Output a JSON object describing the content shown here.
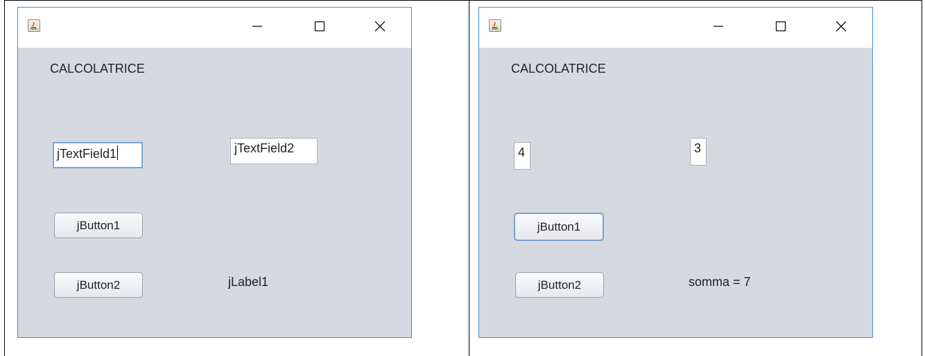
{
  "panels": [
    {
      "title_label": "CALCOLATRICE",
      "field1": {
        "value": "jTextField1"
      },
      "field2": {
        "value": "jTextField2"
      },
      "button1_label": "jButton1",
      "button2_label": "jButton2",
      "result_label": "jLabel1"
    },
    {
      "title_label": "CALCOLATRICE",
      "field1": {
        "value": "4"
      },
      "field2": {
        "value": "3"
      },
      "button1_label": "jButton1",
      "button2_label": "jButton2",
      "result_label": "somma = 7"
    }
  ],
  "icons": {
    "app": "java-cup-icon",
    "minimize": "minimize-icon",
    "maximize": "maximize-icon",
    "close": "close-icon"
  }
}
